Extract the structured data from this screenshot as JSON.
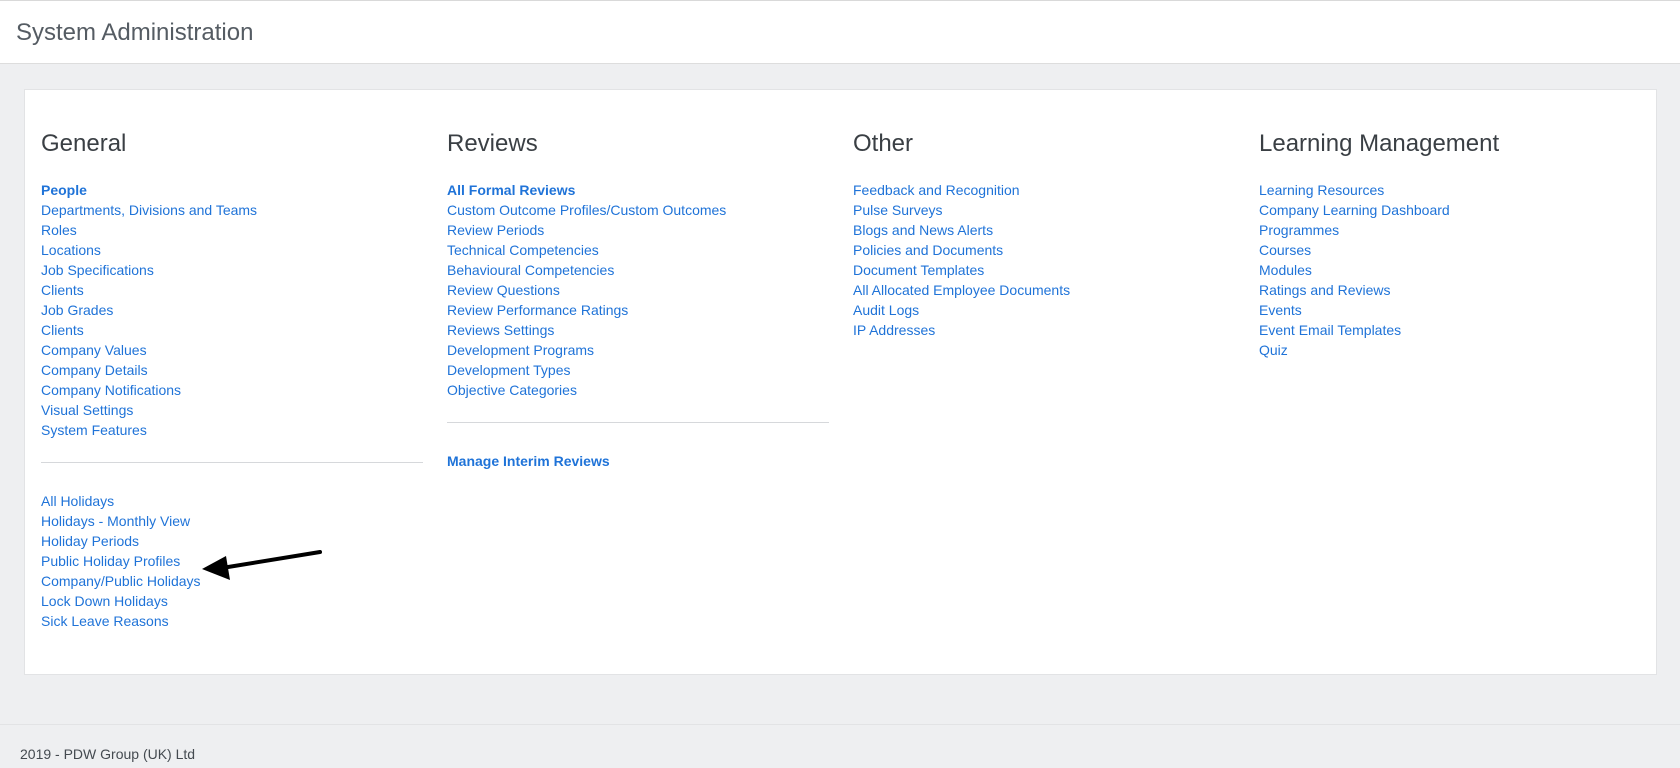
{
  "header": {
    "title": "System Administration"
  },
  "columns": [
    {
      "title": "General",
      "groups": [
        [
          {
            "label": "People",
            "strong": true
          },
          {
            "label": "Departments, Divisions and Teams"
          },
          {
            "label": "Roles"
          },
          {
            "label": "Locations"
          },
          {
            "label": "Job Specifications"
          },
          {
            "label": "Clients"
          },
          {
            "label": "Job Grades"
          },
          {
            "label": "Clients"
          },
          {
            "label": "Company Values"
          },
          {
            "label": "Company Details"
          },
          {
            "label": "Company Notifications"
          },
          {
            "label": "Visual Settings"
          },
          {
            "label": "System Features"
          }
        ],
        [
          {
            "label": "All Holidays"
          },
          {
            "label": "Holidays - Monthly View"
          },
          {
            "label": "Holiday Periods"
          },
          {
            "label": "Public Holiday Profiles"
          },
          {
            "label": "Company/Public Holidays"
          },
          {
            "label": "Lock Down Holidays"
          },
          {
            "label": "Sick Leave Reasons"
          }
        ]
      ]
    },
    {
      "title": "Reviews",
      "groups": [
        [
          {
            "label": "All Formal Reviews",
            "strong": true
          },
          {
            "label": "Custom Outcome Profiles/Custom Outcomes"
          },
          {
            "label": "Review Periods"
          },
          {
            "label": "Technical Competencies"
          },
          {
            "label": "Behavioural Competencies"
          },
          {
            "label": "Review Questions"
          },
          {
            "label": "Review Performance Ratings"
          },
          {
            "label": "Reviews Settings"
          },
          {
            "label": "Development Programs"
          },
          {
            "label": "Development Types"
          },
          {
            "label": "Objective Categories"
          }
        ],
        [
          {
            "label": "Manage Interim Reviews",
            "strong": true
          }
        ]
      ]
    },
    {
      "title": "Other",
      "groups": [
        [
          {
            "label": "Feedback and Recognition"
          },
          {
            "label": "Pulse Surveys"
          },
          {
            "label": "Blogs and News Alerts"
          },
          {
            "label": "Policies and Documents"
          },
          {
            "label": "Document Templates"
          },
          {
            "label": "All Allocated Employee Documents"
          },
          {
            "label": "Audit Logs"
          },
          {
            "label": "IP Addresses"
          }
        ]
      ]
    },
    {
      "title": "Learning Management",
      "groups": [
        [
          {
            "label": "Learning Resources"
          },
          {
            "label": "Company Learning Dashboard"
          },
          {
            "label": "Programmes"
          },
          {
            "label": "Courses"
          },
          {
            "label": "Modules"
          },
          {
            "label": "Ratings and Reviews"
          },
          {
            "label": "Events"
          },
          {
            "label": "Event Email Templates"
          },
          {
            "label": "Quiz"
          }
        ]
      ]
    }
  ],
  "footer": {
    "text": "2019 - PDW Group (UK) Ltd"
  },
  "annotation": {
    "icon": "arrow-left-icon",
    "color": "#000000"
  },
  "colors": {
    "link": "#1f73d8",
    "background": "#eeeff1"
  }
}
